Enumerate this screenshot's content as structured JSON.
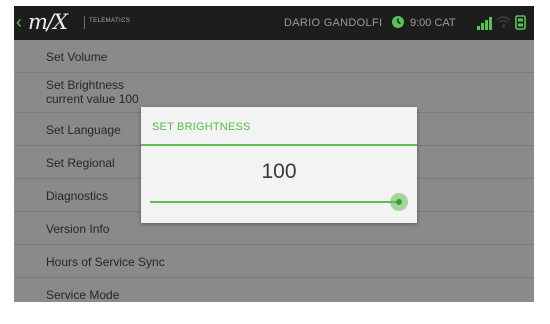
{
  "status_bar": {
    "back_glyph": "‹",
    "logo_text": "m/X",
    "logo_subtitle": "TELEMATICS",
    "user_name": "DARIO GANDOLFI",
    "time": "9:00 CAT",
    "icons": [
      "chevron-left-icon",
      "clock-icon",
      "signal-bars-icon",
      "wifi-icon",
      "device-icon"
    ],
    "icon_color": "#59c157"
  },
  "menu": {
    "items": [
      {
        "label": "Set Volume"
      },
      {
        "label": "Set Brightness",
        "sub": "current value 100"
      },
      {
        "label": "Set Language"
      },
      {
        "label": "Set Regional"
      },
      {
        "label": "Diagnostics"
      },
      {
        "label": "Version Info"
      },
      {
        "label": "Hours of Service Sync"
      },
      {
        "label": "Service Mode"
      }
    ]
  },
  "dialog": {
    "title": "SET BRIGHTNESS",
    "value": "100",
    "slider_level": 1.0,
    "accent_color": "#5fbd52"
  }
}
